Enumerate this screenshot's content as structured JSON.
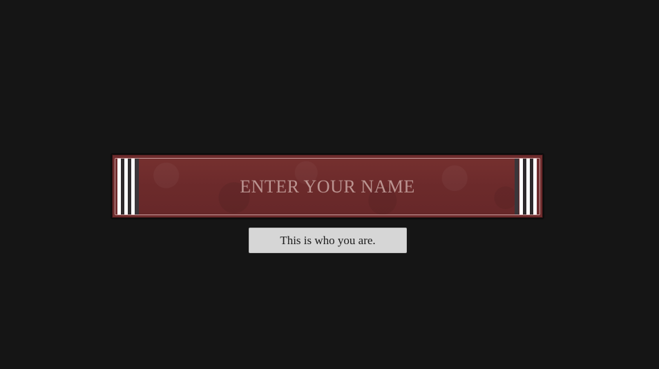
{
  "name_entry": {
    "placeholder": "ENTER YOUR NAME",
    "value": ""
  },
  "subtitle": {
    "text": "This is who you are."
  },
  "colors": {
    "background": "#151515",
    "banner_red": "#6e2c2d",
    "placeholder_text": "#c9a7a3",
    "caption_box": "#d6d6d6",
    "caption_text": "#1b1b1b"
  }
}
